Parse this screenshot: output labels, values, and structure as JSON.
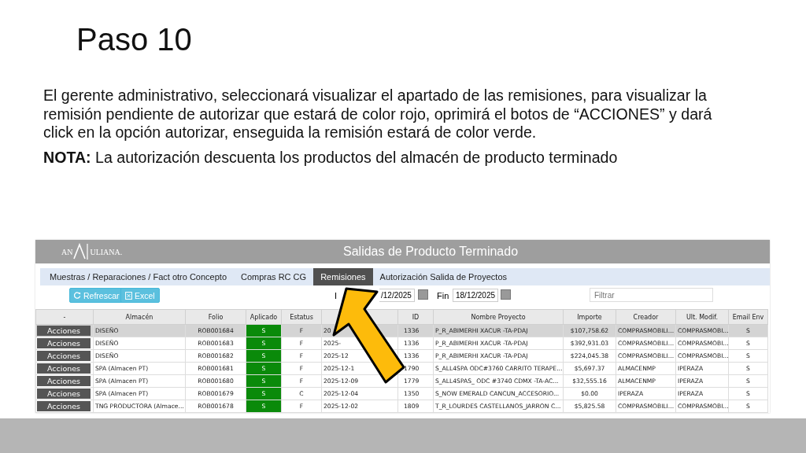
{
  "slide": {
    "title": "Paso 10",
    "paragraph": "El gerente administrativo, seleccionará visualizar el apartado de las remisiones, para visualizar la remisión pendiente de autorizar que estará de color rojo, oprimirá el botos de “ACCIONES” y dará click en la opción autorizar, enseguida la remisión estará de color verde.",
    "note": "**NOTA:** La autorización descuenta los productos del almacén de producto terminado"
  },
  "app": {
    "logo": "AN",
    "logo_rest": "ULIANA.",
    "title": "Salidas de Producto Terminado",
    "tabs": [
      {
        "label": "Muestras / Reparaciones / Fact otro Concepto",
        "selected": false
      },
      {
        "label": "Compras RC CG",
        "selected": false
      },
      {
        "label": "Remisiones",
        "selected": true
      },
      {
        "label": "Autorización Salida de Proyectos",
        "selected": false
      }
    ],
    "buttons": [
      "Refrescar",
      "Excel"
    ],
    "start_label": "I",
    "start_value": "/12/2025",
    "end_label": "Fin",
    "end_value": "18/12/2025",
    "filter": {
      "placeholder": "Filtrar"
    },
    "table": {
      "columns": [
        "-",
        "Almacén",
        "Folio",
        "Aplicado",
        "Estatus",
        "",
        "ID",
        "Nombre Proyecto",
        "Importe",
        "Creador",
        "Ult. Modif.",
        "Email Env"
      ],
      "rows": [
        {
          "selected": true,
          "cells": [
            "Acciones",
            "DISEÑO",
            "ROB001684",
            "S",
            "F",
            "20",
            "1336",
            "P_R_ABIMERHI XACUR -TA-PDAJ",
            "$107,758.62",
            "COMPRASMOBILI...",
            "COMPRASMOBI...",
            "S"
          ]
        },
        {
          "selected": false,
          "cells": [
            "Acciones",
            "DISEÑO",
            "ROB001683",
            "S",
            "F",
            "2025-",
            "1336",
            "P_R_ABIMERHI XACUR -TA-PDAJ",
            "$392,931.03",
            "COMPRASMOBILI...",
            "COMPRASMOBI...",
            "S"
          ]
        },
        {
          "selected": false,
          "cells": [
            "Acciones",
            "DISEÑO",
            "ROB001682",
            "S",
            "F",
            "2025-12",
            "1336",
            "P_R_ABIMERHI XACUR -TA-PDAJ",
            "$224,045.38",
            "COMPRASMOBILI...",
            "COMPRASMOBI...",
            "S"
          ]
        },
        {
          "selected": false,
          "cells": [
            "Acciones",
            "SPA (Almacen PT)",
            "ROB001681",
            "S",
            "F",
            "2025-12-1",
            "1790",
            "S_ALL4SPA ODC#3760 CARRITO TERAPE...",
            "$5,697.37",
            "ALMACENMP",
            "IPERAZA",
            "S"
          ]
        },
        {
          "selected": false,
          "cells": [
            "Acciones",
            "SPA (Almacen PT)",
            "ROB001680",
            "S",
            "F",
            "2025-12-09",
            "1779",
            "S_ALL4SPAS_ ODC #3740 CDMX -TA-AC...",
            "$32,555.16",
            "ALMACENMP",
            "IPERAZA",
            "S"
          ]
        },
        {
          "selected": false,
          "cells": [
            "Acciones",
            "SPA (Almacen PT)",
            "ROB001679",
            "S",
            "C",
            "2025-12-04",
            "1350",
            "S_NOW EMERALD CANCUN_ACCESORIO...",
            "$0.00",
            "IPERAZA",
            "IPERAZA",
            "S"
          ]
        },
        {
          "selected": false,
          "cells": [
            "Acciones",
            "TNG PRODUCTORA (Almace...",
            "ROB001678",
            "S",
            "F",
            "2025-12-02",
            "1809",
            "T_R_LOURDES CASTELLANOS_JARRON C...",
            "$5,825.58",
            "COMPRASMOBILI...",
            "COMPRASMOBI...",
            "S"
          ]
        }
      ]
    }
  }
}
